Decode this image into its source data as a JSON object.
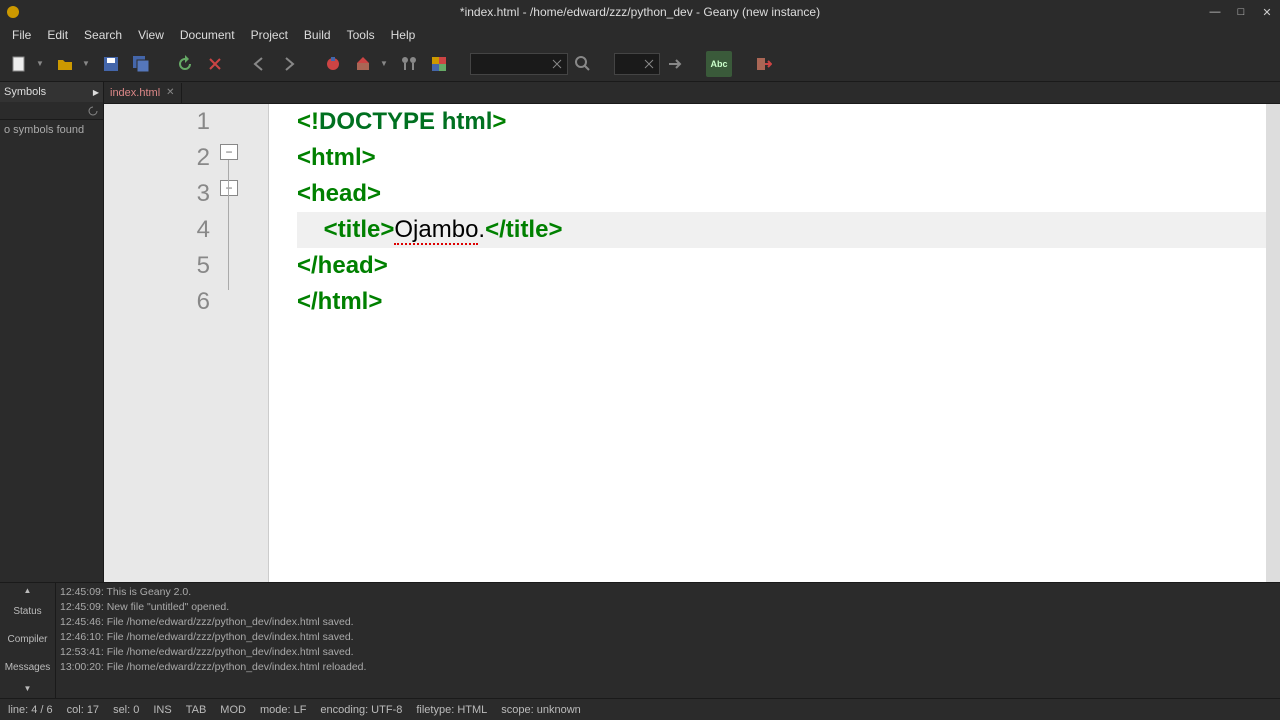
{
  "title": "*index.html - /home/edward/zzz/python_dev - Geany (new instance)",
  "menu": [
    "File",
    "Edit",
    "Search",
    "View",
    "Document",
    "Project",
    "Build",
    "Tools",
    "Help"
  ],
  "sidebar": {
    "header": "Symbols",
    "content": "o symbols found"
  },
  "tab": {
    "name": "index.html"
  },
  "code": {
    "lines": [
      {
        "n": "1",
        "parts": [
          {
            "t": "<!",
            "c": "tag"
          },
          {
            "t": "DOCTYPE",
            "c": "kw"
          },
          {
            "t": " ",
            "c": "txt"
          },
          {
            "t": "html",
            "c": "kw"
          },
          {
            "t": ">",
            "c": "tag"
          }
        ]
      },
      {
        "n": "2",
        "parts": [
          {
            "t": "<html>",
            "c": "tag"
          }
        ]
      },
      {
        "n": "3",
        "parts": [
          {
            "t": "<head>",
            "c": "tag"
          }
        ]
      },
      {
        "n": "4",
        "current": true,
        "parts": [
          {
            "t": "    ",
            "c": "txt"
          },
          {
            "t": "<title>",
            "c": "tag"
          },
          {
            "t": "Ojambo",
            "c": "txt squiggle"
          },
          {
            "t": ".",
            "c": "txt"
          },
          {
            "t": "</title>",
            "c": "tag"
          }
        ]
      },
      {
        "n": "5",
        "parts": [
          {
            "t": "</head>",
            "c": "tag"
          }
        ]
      },
      {
        "n": "6",
        "parts": [
          {
            "t": "</html>",
            "c": "tag"
          }
        ]
      }
    ]
  },
  "messages": [
    "12:45:09: This is Geany 2.0.",
    "12:45:09: New file \"untitled\" opened.",
    "12:45:46: File /home/edward/zzz/python_dev/index.html saved.",
    "12:46:10: File /home/edward/zzz/python_dev/index.html saved.",
    "12:53:41: File /home/edward/zzz/python_dev/index.html saved.",
    "13:00:20: File /home/edward/zzz/python_dev/index.html reloaded."
  ],
  "bottom_tabs": [
    "Status",
    "Compiler",
    "Messages"
  ],
  "status": {
    "line": "line: 4 / 6",
    "col": "col: 17",
    "sel": "sel: 0",
    "ins": "INS",
    "tab": "TAB",
    "mod": "MOD",
    "mode": "mode: LF",
    "encoding": "encoding: UTF-8",
    "filetype": "filetype: HTML",
    "scope": "scope: unknown"
  }
}
